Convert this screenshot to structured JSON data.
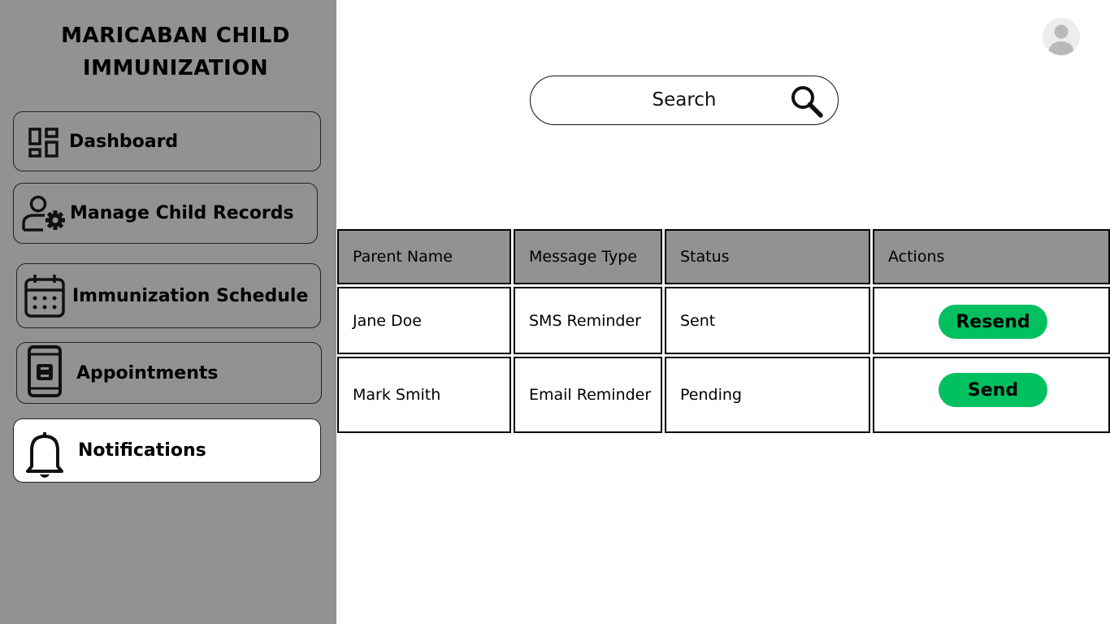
{
  "app": {
    "title_line1": "MARICABAN CHILD",
    "title_line2": "IMMUNIZATION"
  },
  "sidebar": {
    "items": [
      {
        "label": "Dashboard",
        "icon": "dashboard-icon",
        "active": false
      },
      {
        "label": "Manage Child Records",
        "icon": "user-gear-icon",
        "active": false
      },
      {
        "label": "Immunization Schedule",
        "icon": "calendar-icon",
        "active": false
      },
      {
        "label": "Appointments",
        "icon": "phone-icon",
        "active": false
      },
      {
        "label": "Notifications",
        "icon": "bell-icon",
        "active": true
      }
    ]
  },
  "header": {
    "avatar_icon": "user-avatar-icon"
  },
  "search": {
    "placeholder": "Search",
    "icon": "search-icon"
  },
  "table": {
    "columns": [
      "Parent Name",
      "Message Type",
      "Status",
      "Actions"
    ],
    "rows": [
      {
        "parent_name": "Jane Doe",
        "message_type": "SMS Reminder",
        "status": "Sent",
        "action": "Resend"
      },
      {
        "parent_name": "Mark Smith",
        "message_type": "Email Reminder",
        "status": "Pending",
        "action": "Send"
      }
    ]
  },
  "colors": {
    "sidebar_bg": "#929292",
    "header_bg": "#929292",
    "action_button": "#00c060",
    "active_item_bg": "#ffffff"
  }
}
